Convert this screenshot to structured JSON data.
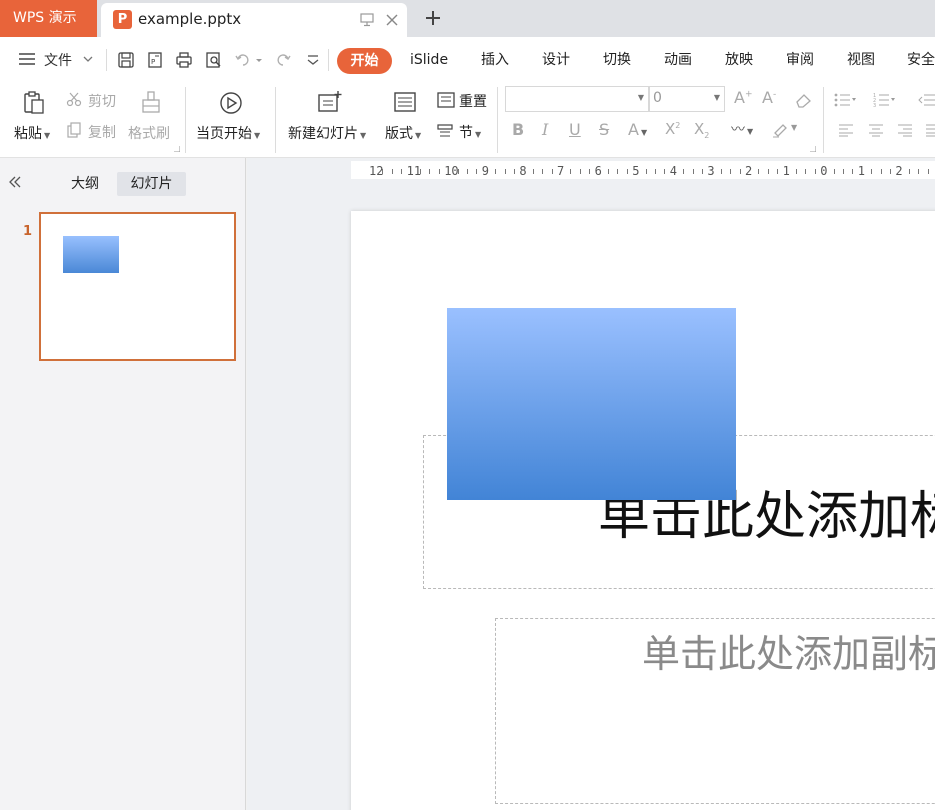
{
  "titlebar": {
    "app_label": "WPS 演示",
    "doc_name": "example.pptx",
    "doc_icon_letter": "P"
  },
  "menubar": {
    "file_label": "文件",
    "tabs": [
      "开始",
      "iSlide",
      "插入",
      "设计",
      "切换",
      "动画",
      "放映",
      "审阅",
      "视图",
      "安全"
    ]
  },
  "ribbon": {
    "paste": "粘贴",
    "cut": "剪切",
    "copy": "复制",
    "format_painter": "格式刷",
    "from_current": "当页开始",
    "new_slide": "新建幻灯片",
    "layout": "版式",
    "section": "节",
    "reset": "重置",
    "font_name": "",
    "font_size": "0"
  },
  "leftpanel": {
    "tab_outline": "大纲",
    "tab_slides": "幻灯片",
    "slide_number": "1"
  },
  "ruler": {
    "labels": [
      "12",
      "11",
      "10",
      "9",
      "8",
      "7",
      "6",
      "5",
      "4",
      "3",
      "2",
      "1",
      "0",
      "1",
      "2"
    ]
  },
  "slide": {
    "title_placeholder": "单击此处添加标题",
    "subtitle_placeholder": "单击此处添加副标题"
  },
  "colors": {
    "accent": "#e8643a",
    "shape_top": "#9ac0ff",
    "shape_bottom": "#4284d6"
  }
}
